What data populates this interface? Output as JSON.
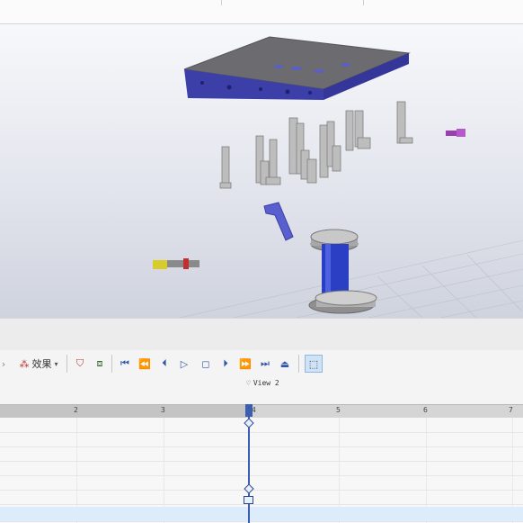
{
  "scene": {
    "colors": {
      "plate_top": "#6b6b70",
      "plate_side": "#3d3fa8",
      "pin": "#b9b9b9",
      "blue_part": "#2a3fc4",
      "purple_part": "#9a3fb0",
      "yellow_part": "#d8cc2a"
    }
  },
  "toolbar": {
    "effects_label": "效果",
    "icons": [
      "filter-red-icon",
      "filter-page-icon",
      "go-start-icon",
      "step-back-icon",
      "prev-frame-icon",
      "play-icon",
      "stop-icon",
      "next-frame-icon",
      "step-forward-icon",
      "go-end-icon",
      "record-icon",
      "select-mode-icon"
    ]
  },
  "timeline": {
    "view_label": "View 2",
    "ticks": [
      "2",
      "3",
      "4",
      "5",
      "6",
      "7"
    ],
    "current_time": 4
  }
}
